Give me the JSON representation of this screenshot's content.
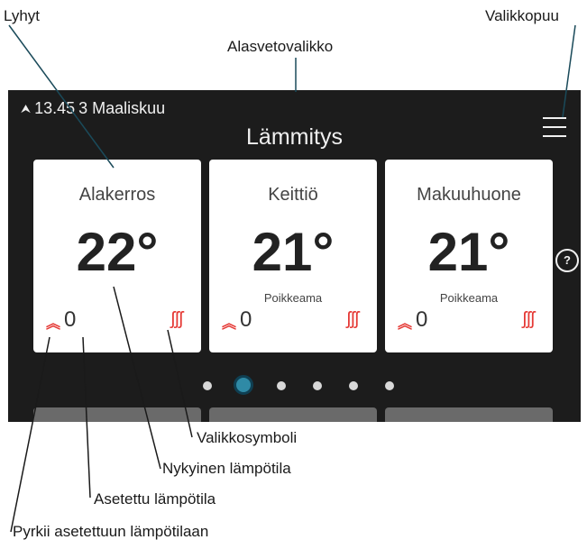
{
  "callouts": {
    "shortcut": "Lyhyt",
    "dropdown": "Alasvetovalikko",
    "menubar": "Valikkopuu",
    "menu_symbol": "Valikkosymboli",
    "current_temp": "Nykyinen lämpötila",
    "set_temp": "Asetettu lämpötila",
    "aim": "Pyrkii asetettuun lämpötilaan"
  },
  "screen": {
    "time": "13.45",
    "date": "3 Maaliskuu",
    "title": "Lämmitys",
    "help": "?"
  },
  "cards": [
    {
      "name": "Alakerros",
      "temp": "22°",
      "offset": "",
      "set": "0"
    },
    {
      "name": "Keittiö",
      "temp": "21°",
      "offset": "Poikkeama",
      "set": "0"
    },
    {
      "name": "Makuuhuone",
      "temp": "21°",
      "offset": "Poikkeama",
      "set": "0"
    }
  ],
  "pagination": {
    "count": 6,
    "active_index": 1
  },
  "icons": {
    "arrows": "double-chevron-up-icon",
    "heat": "heat-waves-icon",
    "menu": "hamburger-menu-icon",
    "upload": "upload-icon"
  },
  "colors": {
    "accent": "#e53935",
    "active_dot": "#2f8aa6",
    "screen_bg": "#1c1c1c"
  }
}
